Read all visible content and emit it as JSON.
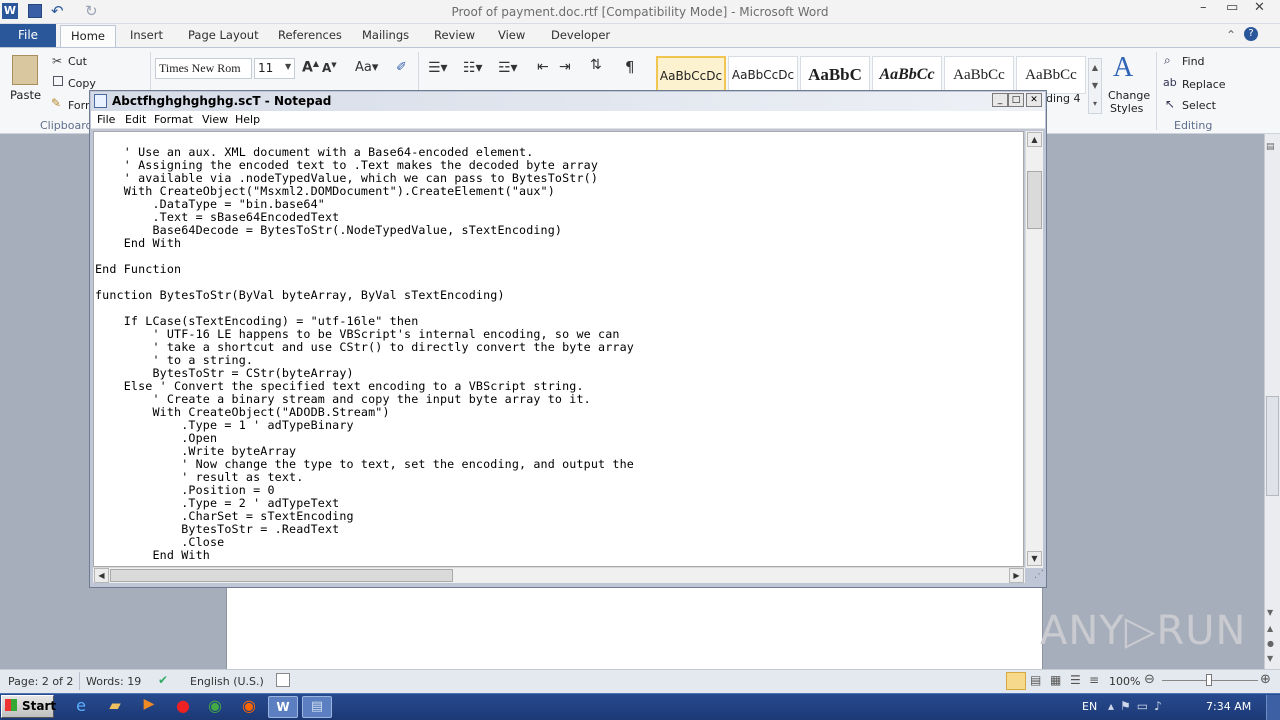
{
  "word": {
    "title": "Proof of payment.doc.rtf [Compatibility Mode] - Microsoft Word",
    "tabs": [
      "File",
      "Home",
      "Insert",
      "Page Layout",
      "References",
      "Mailings",
      "Review",
      "View",
      "Developer"
    ],
    "clipboard": {
      "paste": "Paste",
      "cut": "Cut",
      "copy": "Copy",
      "format": "Forr",
      "group": "Clipboard"
    },
    "font": {
      "name": "Times New Rom",
      "size": "11"
    },
    "styles": [
      "AaBbCcDc",
      "AaBbCcDc",
      "AaBbC",
      "AaBbCc",
      "AaBbCc",
      "AaBbCc"
    ],
    "style_partial": "ding 4",
    "change_styles": [
      "Change",
      "Styles"
    ],
    "editing": {
      "find": "Find",
      "replace": "Replace",
      "select": "Select",
      "group": "Editing"
    },
    "status": {
      "page": "Page: 2 of 2",
      "words": "Words: 19",
      "language": "English (U.S.)",
      "zoom": "100%"
    },
    "watermark": "ANY▷RUN"
  },
  "notepad": {
    "title": "Abctfhghghghghg.scT - Notepad",
    "menu": [
      "File",
      "Edit",
      "Format",
      "View",
      "Help"
    ],
    "text": "    ' Use an aux. XML document with a Base64-encoded element.\n    ' Assigning the encoded text to .Text makes the decoded byte array\n    ' available via .nodeTypedValue, which we can pass to BytesToStr()\n    With CreateObject(\"Msxml2.DOMDocument\").CreateElement(\"aux\")\n        .DataType = \"bin.base64\"\n        .Text = sBase64EncodedText\n        Base64Decode = BytesToStr(.NodeTypedValue, sTextEncoding)\n    End With\n\nEnd Function\n\nfunction BytesToStr(ByVal byteArray, ByVal sTextEncoding)\n\n    If LCase(sTextEncoding) = \"utf-16le\" then\n        ' UTF-16 LE happens to be VBScript's internal encoding, so we can\n        ' take a shortcut and use CStr() to directly convert the byte array\n        ' to a string.\n        BytesToStr = CStr(byteArray)\n    Else ' Convert the specified text encoding to a VBScript string.\n        ' Create a binary stream and copy the input byte array to it.\n        With CreateObject(\"ADODB.Stream\")\n            .Type = 1 ' adTypeBinary\n            .Open\n            .Write byteArray\n            ' Now change the type to text, set the encoding, and output the\n            ' result as text.\n            .Position = 0\n            .Type = 2 ' adTypeText\n            .CharSet = sTextEncoding\n            BytesToStr = .ReadText\n            .Close\n        End With"
  },
  "taskbar": {
    "start": "Start",
    "lang": "EN",
    "clock": "7:34 AM"
  }
}
